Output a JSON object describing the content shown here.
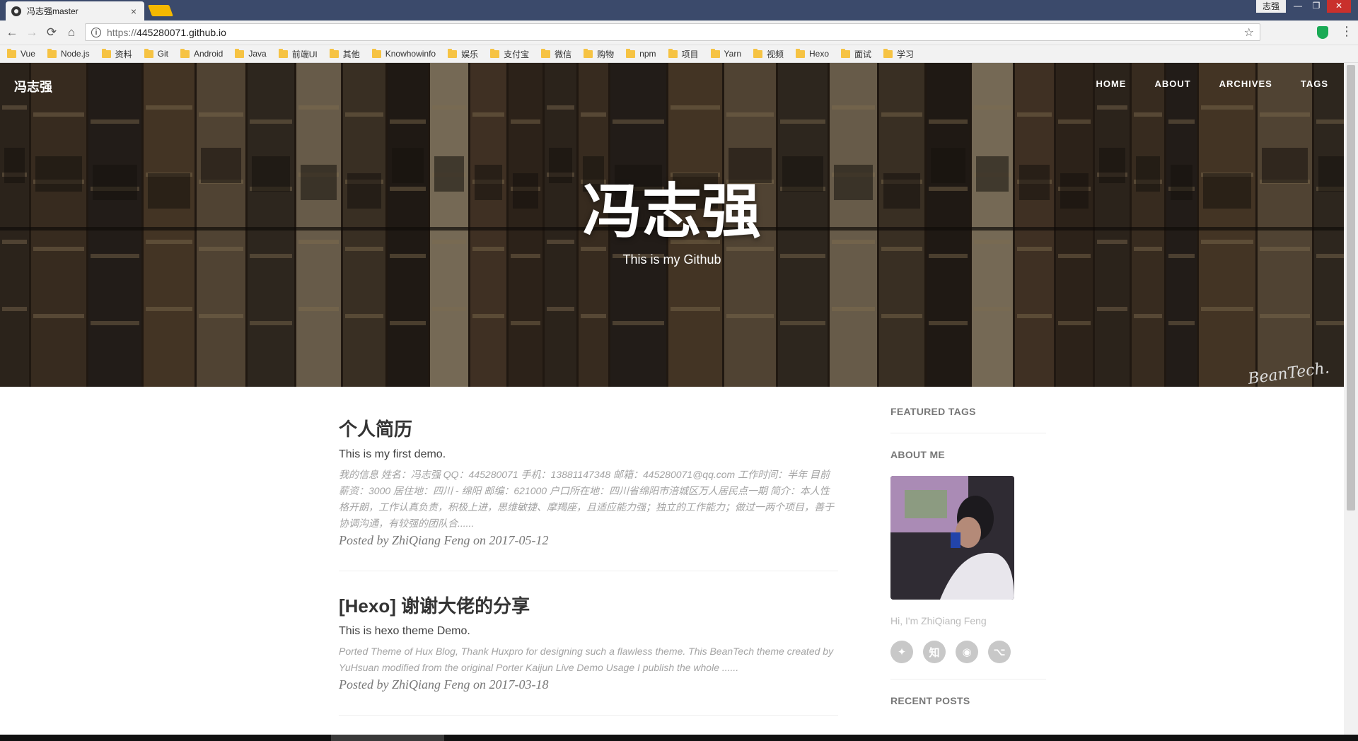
{
  "browser": {
    "tab_title": "冯志强master",
    "tab_close": "×",
    "profile_name": "志强",
    "url_scheme": "https://",
    "url_host": "445280071.github.io",
    "back": "←",
    "forward": "→",
    "reload": "⟳",
    "home": "⌂",
    "star": "☆",
    "menu": "⋮",
    "info": "i",
    "win_minimize": "—",
    "win_restore": "❐",
    "win_close": "✕",
    "bookmarks": [
      "Vue",
      "Node.js",
      "资料",
      "Git",
      "Android",
      "Java",
      "前端UI",
      "其他",
      "Knowhowinfo",
      "娱乐",
      "支付宝",
      "微信",
      "购物",
      "npm",
      "项目",
      "Yarn",
      "视频",
      "Hexo",
      "面试",
      "学习"
    ]
  },
  "site": {
    "name": "冯志强",
    "nav": [
      "HOME",
      "ABOUT",
      "ARCHIVES",
      "TAGS"
    ],
    "hero_title": "冯志强",
    "hero_subtitle": "This is my Github"
  },
  "posts": [
    {
      "title": "个人简历",
      "subtitle": "This is my first demo.",
      "excerpt": "我的信息 姓名：冯志强 QQ：445280071 手机：13881147348 邮箱：445280071@qq.com 工作时间：半年 目前薪资：3000 居住地：四川 - 绵阳 邮编：621000 户口所在地：四川省绵阳市涪城区万人居民点一期 简介：本人性格开朗，工作认真负责，积极上进，思维敏捷、摩羯座，且适应能力强；独立的工作能力；做过一两个项目，善于协调沟通，有较强的团队合......",
      "meta": "Posted by ZhiQiang Feng on 2017-05-12"
    },
    {
      "title": "[Hexo] 谢谢大佬的分享",
      "subtitle": "This is hexo theme Demo.",
      "excerpt": "Ported Theme of Hux Blog, Thank Huxpro for designing such a flawless theme. This BeanTech theme created by YuHsuan modified from the original Porter Kaijun Live Demo Usage I publish the whole ......",
      "meta": "Posted by ZhiQiang Feng on 2017-03-18"
    }
  ],
  "sidebar": {
    "featured_tags": "FEATURED TAGS",
    "about_me": "ABOUT ME",
    "about_text": "Hi, I'm ZhiQiang Feng",
    "recent_posts": "RECENT POSTS",
    "social": [
      {
        "icon": "twitter-icon",
        "glyph": "✦"
      },
      {
        "icon": "zhihu-icon",
        "glyph": "知"
      },
      {
        "icon": "weibo-icon",
        "glyph": "◉"
      },
      {
        "icon": "github-icon",
        "glyph": "⌥"
      }
    ]
  }
}
